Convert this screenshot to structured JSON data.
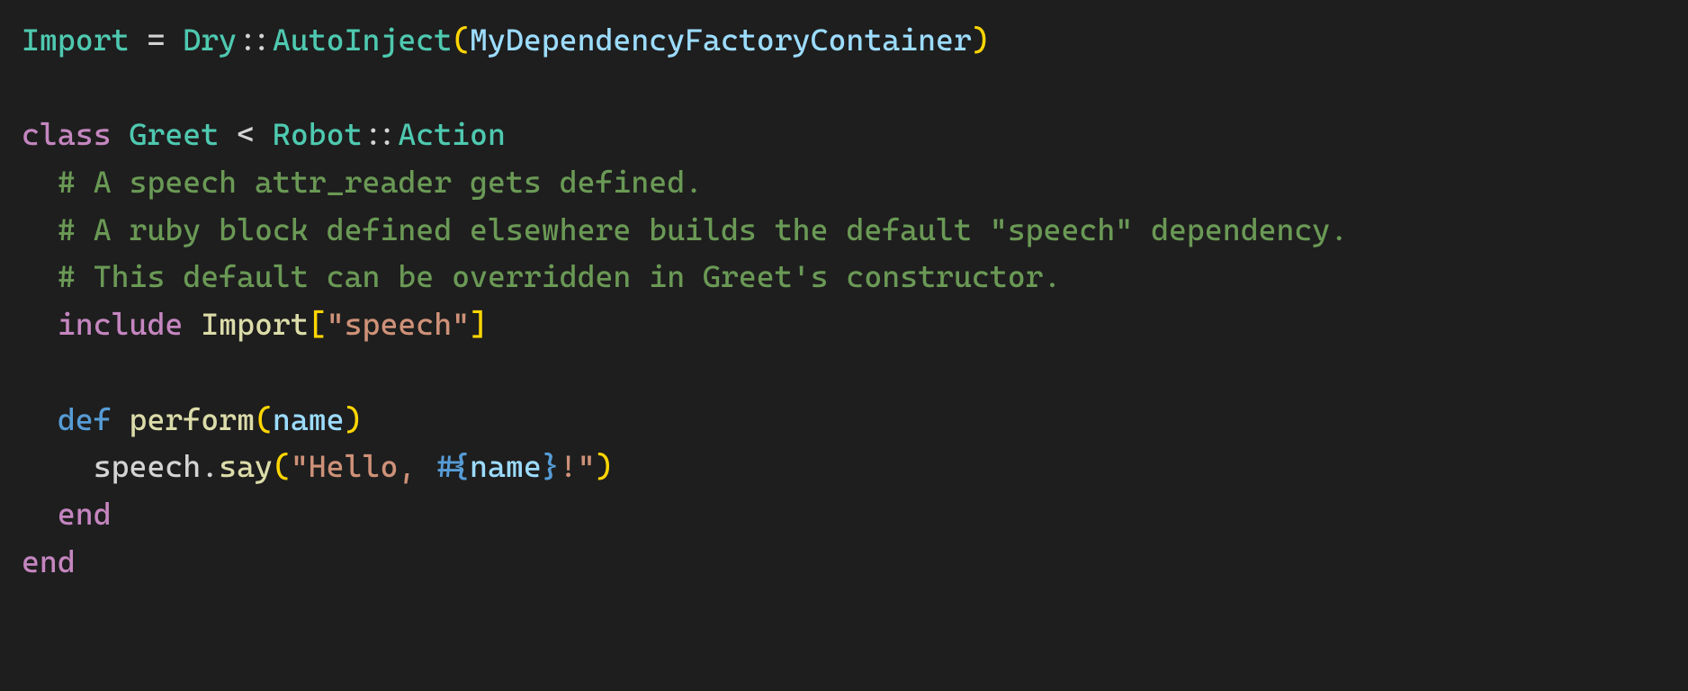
{
  "line1": {
    "import": "Import",
    "eq": " = ",
    "dry": "Dry",
    "scope": "::",
    "autoinject": "AutoInject",
    "lp": "(",
    "container": "MyDependencyFactoryContainer",
    "rp": ")"
  },
  "line3": {
    "class_kw": "class",
    "sp1": " ",
    "classname": "Greet",
    "sp2": " ",
    "lt": "<",
    "sp3": " ",
    "robot": "Robot",
    "scope": "::",
    "action": "Action"
  },
  "comment1": "  # A speech attr_reader gets defined.",
  "comment2": "  # A ruby block defined elsewhere builds the default \"speech\" dependency.",
  "comment3": "  # This default can be overridden in Greet's constructor.",
  "line7": {
    "indent": "  ",
    "include": "include",
    "sp": " ",
    "import": "Import",
    "lbr": "[",
    "str": "\"speech\"",
    "rbr": "]"
  },
  "line9": {
    "indent": "  ",
    "def": "def",
    "sp": " ",
    "fn": "perform",
    "lp": "(",
    "arg": "name",
    "rp": ")"
  },
  "line10": {
    "indent": "    ",
    "recv": "speech",
    "dot": ".",
    "method": "say",
    "lp": "(",
    "s1": "\"Hello, ",
    "io": "#{",
    "iv": "name",
    "ic": "}",
    "s2": "!\"",
    "rp": ")"
  },
  "end1": "  end",
  "end2": "end"
}
